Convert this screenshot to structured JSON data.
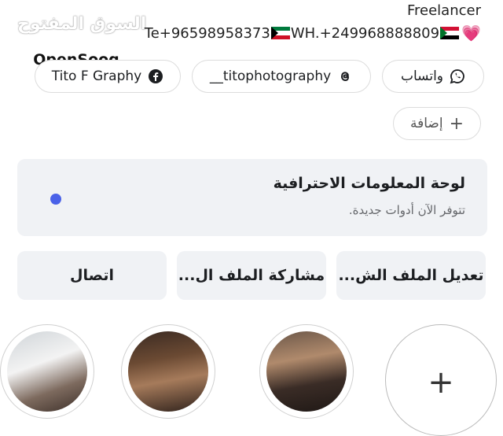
{
  "header": {
    "title": "Freelancer",
    "watermark": "السوق المفتوح",
    "brand": "OpenSooq",
    "contact_prefix": "Te+96598958373",
    "contact_mid": "WH.+249968888809"
  },
  "links": {
    "facebook_label": "Tito F Graphy",
    "threads_label": "__titophotography",
    "whatsapp_label": "واتساب",
    "add_label": "إضافة"
  },
  "dashboard": {
    "title": "لوحة المعلومات الاحترافية",
    "subtitle": "تتوفر الآن أدوات جديدة."
  },
  "actions": {
    "edit": "تعديل الملف الش...",
    "share": "مشاركة الملف ال...",
    "contact": "اتصال"
  },
  "highlights": {
    "new_symbol": "+"
  },
  "colors": {
    "accent_dot": "#4a62e8",
    "card_bg": "#f0f2f5"
  },
  "icons": [
    "facebook-icon",
    "threads-icon",
    "whatsapp-icon",
    "plus-icon",
    "kuwait-flag-icon",
    "sudan-flag-icon",
    "heart-icon"
  ]
}
